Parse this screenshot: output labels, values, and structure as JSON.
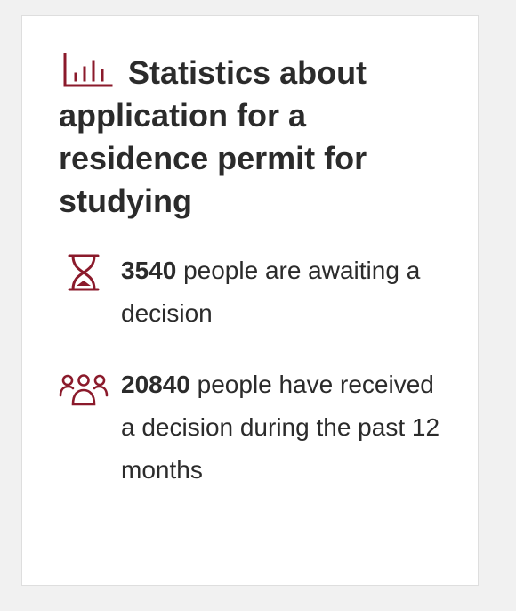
{
  "card": {
    "title": "Statistics about application for a residence permit for studying",
    "title_icon": "bar-chart-icon",
    "accent_color": "#8b1a2b"
  },
  "stats": [
    {
      "icon": "hourglass-icon",
      "number": "3540",
      "text": " people are awaiting a decision"
    },
    {
      "icon": "people-group-icon",
      "number": "20840",
      "text": " people have received a decision during the past 12 months"
    }
  ]
}
